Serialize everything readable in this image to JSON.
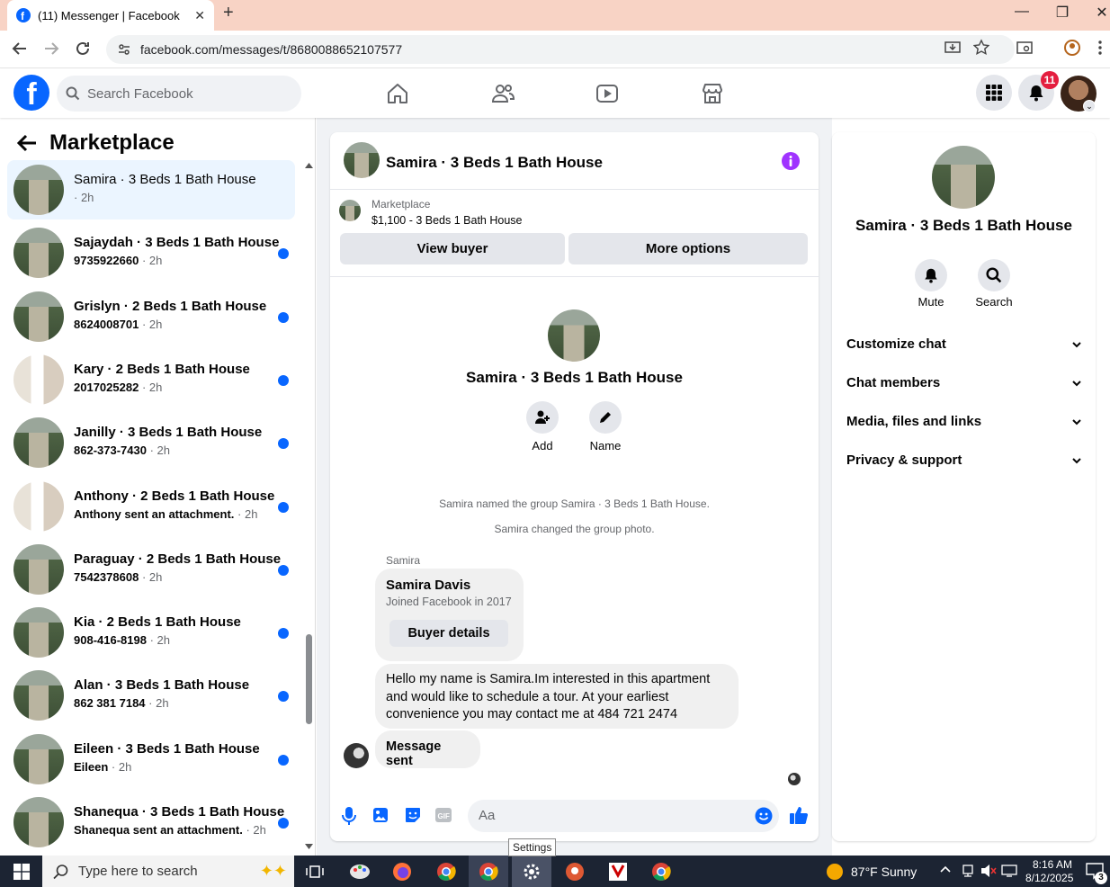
{
  "browser": {
    "tab_title": "(11) Messenger | Facebook",
    "url": "facebook.com/messages/t/8680088652107577"
  },
  "fb_header": {
    "search_placeholder": "Search Facebook",
    "notification_count": "11"
  },
  "left_panel": {
    "title": "Marketplace",
    "conversations": [
      {
        "name": "Samira · 3 Beds 1 Bath House",
        "preview": "",
        "time": "· 2h",
        "active": true,
        "unread": false
      },
      {
        "name": "Sajaydah · 3 Beds 1 Bath House",
        "preview": "9735922660",
        "time": "· 2h",
        "unread": true
      },
      {
        "name": "Grislyn · 2 Beds 1 Bath House",
        "preview": "8624008701",
        "time": "· 2h",
        "unread": true
      },
      {
        "name": "Kary · 2 Beds 1 Bath House",
        "preview": "2017025282",
        "time": "· 2h",
        "unread": true
      },
      {
        "name": "Janilly · 3 Beds 1 Bath House",
        "preview": "862-373-7430",
        "time": "· 2h",
        "unread": true
      },
      {
        "name": "Anthony · 2 Beds 1 Bath House",
        "preview": "Anthony sent an attachment.",
        "time": "· 2h",
        "unread": true
      },
      {
        "name": "Paraguay · 2 Beds 1 Bath House",
        "preview": "7542378608",
        "time": "· 2h",
        "unread": true
      },
      {
        "name": "Kia · 2 Beds 1 Bath House",
        "preview": "908-416-8198",
        "time": "· 2h",
        "unread": true
      },
      {
        "name": "Alan · 3 Beds 1 Bath House",
        "preview": "862 381 7184",
        "time": "· 2h",
        "unread": true
      },
      {
        "name": "Eileen · 3 Beds 1 Bath House",
        "preview": "Eileen",
        "time": "· 2h",
        "unread": true
      },
      {
        "name": "Shanequa · 3 Beds 1 Bath House",
        "preview": "Shanequa sent an attachment.",
        "time": "· 2h",
        "unread": true
      }
    ]
  },
  "chat": {
    "title": "Samira · 3 Beds 1 Bath House",
    "marketplace_label": "Marketplace",
    "listing": "$1,100 - 3 Beds 1 Bath House",
    "view_buyer": "View buyer",
    "more_options": "More options",
    "group_title": "Samira · 3 Beds 1 Bath House",
    "add_label": "Add",
    "name_label": "Name",
    "system_msgs": [
      "Samira named the group Samira · 3 Beds 1 Bath House.",
      "Samira changed the group photo."
    ],
    "sender": "Samira",
    "buyer_card": {
      "name": "Samira Davis",
      "joined": "Joined Facebook in 2017",
      "button": "Buyer details"
    },
    "message_lines": [
      "Hello my name is Samira.Im interested in this apartment",
      "and would like to schedule a tour. At your earliest",
      "convenience you may contact me at 484 721 2474"
    ],
    "auto_msg": "Message sent",
    "input_placeholder": "Aa"
  },
  "right_panel": {
    "title": "Samira · 3 Beds 1 Bath House",
    "mute": "Mute",
    "search": "Search",
    "sections": [
      "Customize chat",
      "Chat members",
      "Media, files and links",
      "Privacy & support"
    ]
  },
  "tooltip": "Settings",
  "taskbar": {
    "search_placeholder": "Type here to search",
    "weather": "87°F  Sunny",
    "time": "8:16 AM",
    "date": "8/12/2025",
    "notif_count": "3"
  },
  "colors": {
    "fb_blue": "#0866ff",
    "messenger_purple": "#a033ff",
    "unread_dot": "#0866ff",
    "title_bar": "#f8d3c5"
  }
}
